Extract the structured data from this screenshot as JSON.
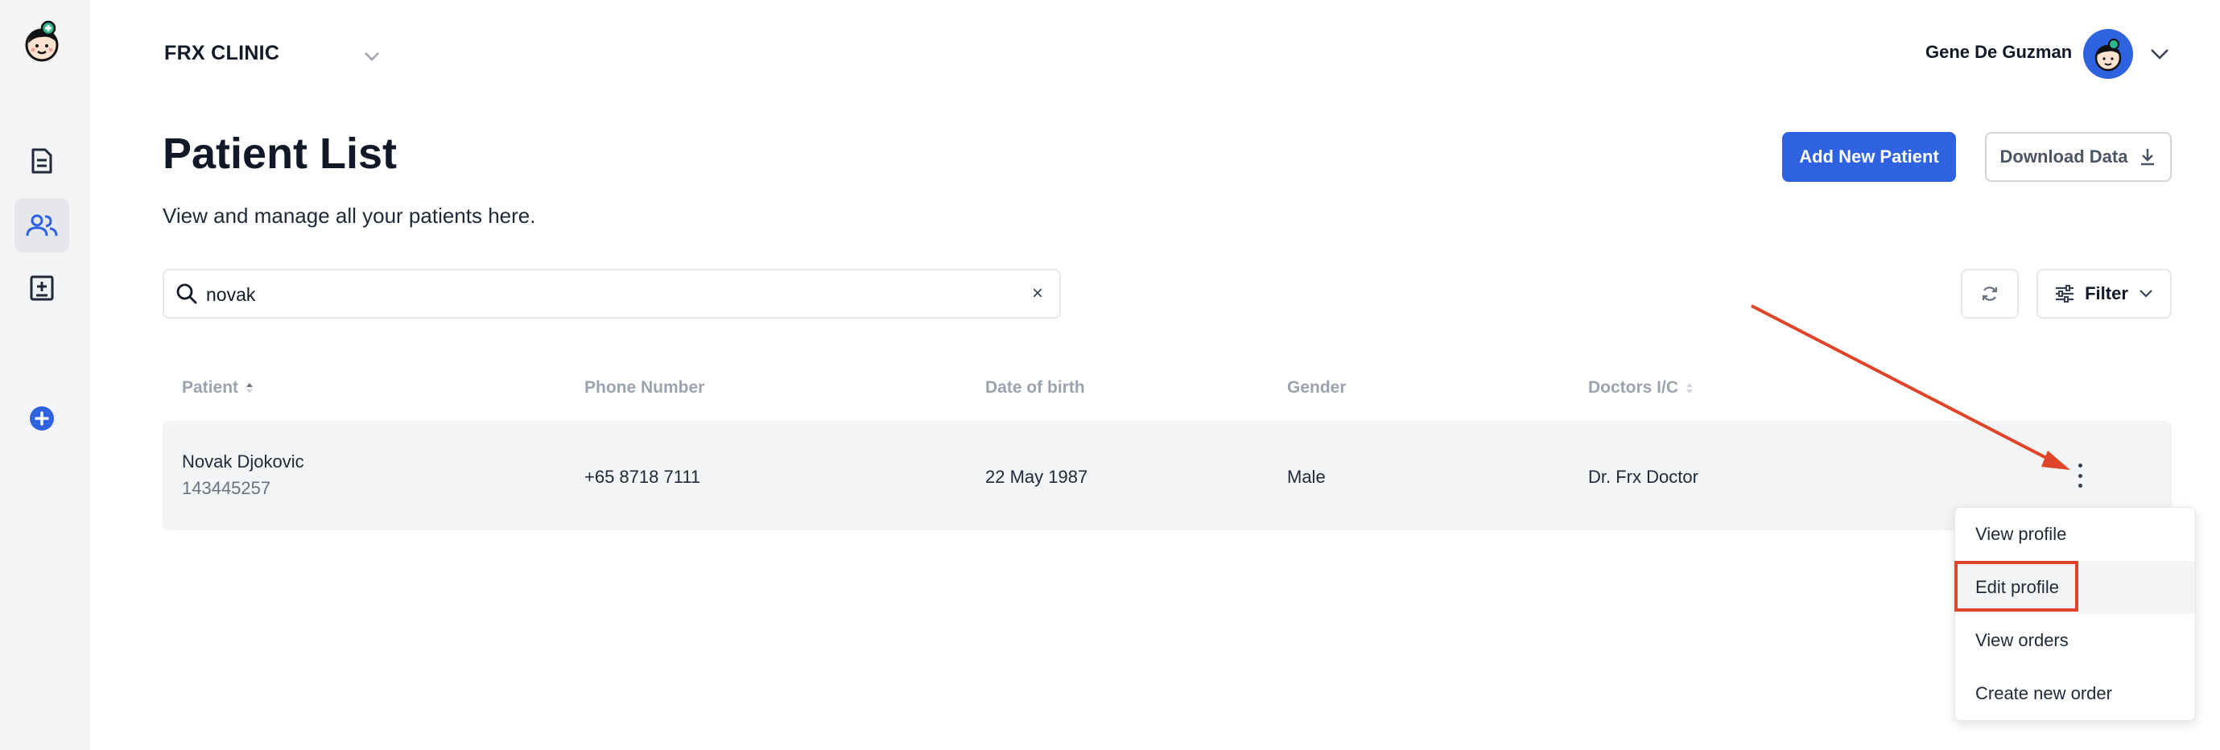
{
  "sidebar": {
    "items": [
      {
        "icon": "document-icon",
        "active": false
      },
      {
        "icon": "patients-icon",
        "active": true
      },
      {
        "icon": "add-record-icon",
        "active": false
      },
      {
        "icon": "plus-circle-icon",
        "active": false
      }
    ]
  },
  "header": {
    "clinic_name": "FRX CLINIC",
    "user_name": "Gene De Guzman"
  },
  "page": {
    "title": "Patient List",
    "subtitle": "View and manage all your patients here."
  },
  "actions": {
    "add_label": "Add New Patient",
    "download_label": "Download Data",
    "filter_label": "Filter"
  },
  "search": {
    "value": "novak",
    "clear_glyph": "×"
  },
  "table": {
    "columns": [
      "Patient",
      "Phone Number",
      "Date of birth",
      "Gender",
      "Doctors I/C"
    ],
    "rows": [
      {
        "name": "Novak Djokovic",
        "id": "143445257",
        "phone": "+65 8718 7111",
        "dob": "22 May 1987",
        "gender": "Male",
        "doctor": "Dr. Frx Doctor"
      }
    ]
  },
  "row_menu": {
    "items": [
      "View profile",
      "Edit profile",
      "View orders",
      "Create new order"
    ],
    "highlighted": "Edit profile"
  },
  "colors": {
    "primary": "#2f62e0",
    "annotation": "#e04428",
    "row_bg": "#f3f4f6",
    "muted_text": "#9ca3af"
  }
}
